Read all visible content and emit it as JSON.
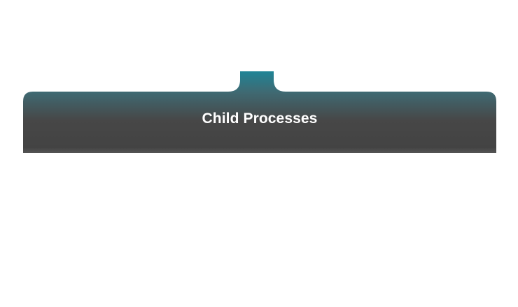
{
  "panel": {
    "title": "Child Processes",
    "tab_color": "#1f8496",
    "header_top_color": "#3f6a73",
    "header_body_color": "#454545"
  }
}
